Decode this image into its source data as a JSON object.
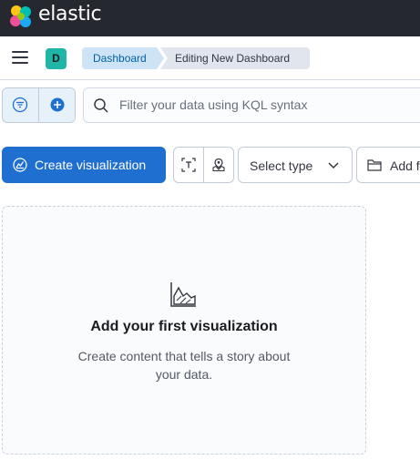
{
  "app": {
    "brand": "elastic"
  },
  "nav": {
    "avatar_letter": "D",
    "breadcrumbs": [
      {
        "label": "Dashboard"
      },
      {
        "label": "Editing New Dashboard"
      }
    ]
  },
  "query": {
    "search_placeholder": "Filter your data using KQL syntax"
  },
  "toolbar": {
    "create_label": "Create visualization",
    "select_type_label": "Select type",
    "add_from_label": "Add f"
  },
  "empty_panel": {
    "title": "Add your first visualization",
    "description": "Create content that tells a story about your data."
  },
  "icons": {
    "menu": "hamburger-icon",
    "filter": "filter-icon",
    "add_filter": "plus-circle-icon",
    "search": "search-icon",
    "create": "visualize-app-icon",
    "text": "text-panel-icon",
    "map": "map-marker-icon",
    "dropdown": "chevron-down-icon",
    "folder": "folder-icon",
    "empty_chart": "area-chart-icon"
  },
  "colors": {
    "topbar": "#25282f",
    "primary": "#1f6fd1",
    "avatar": "#20b5a6",
    "breadcrumb_active": "#cfe3f6"
  }
}
